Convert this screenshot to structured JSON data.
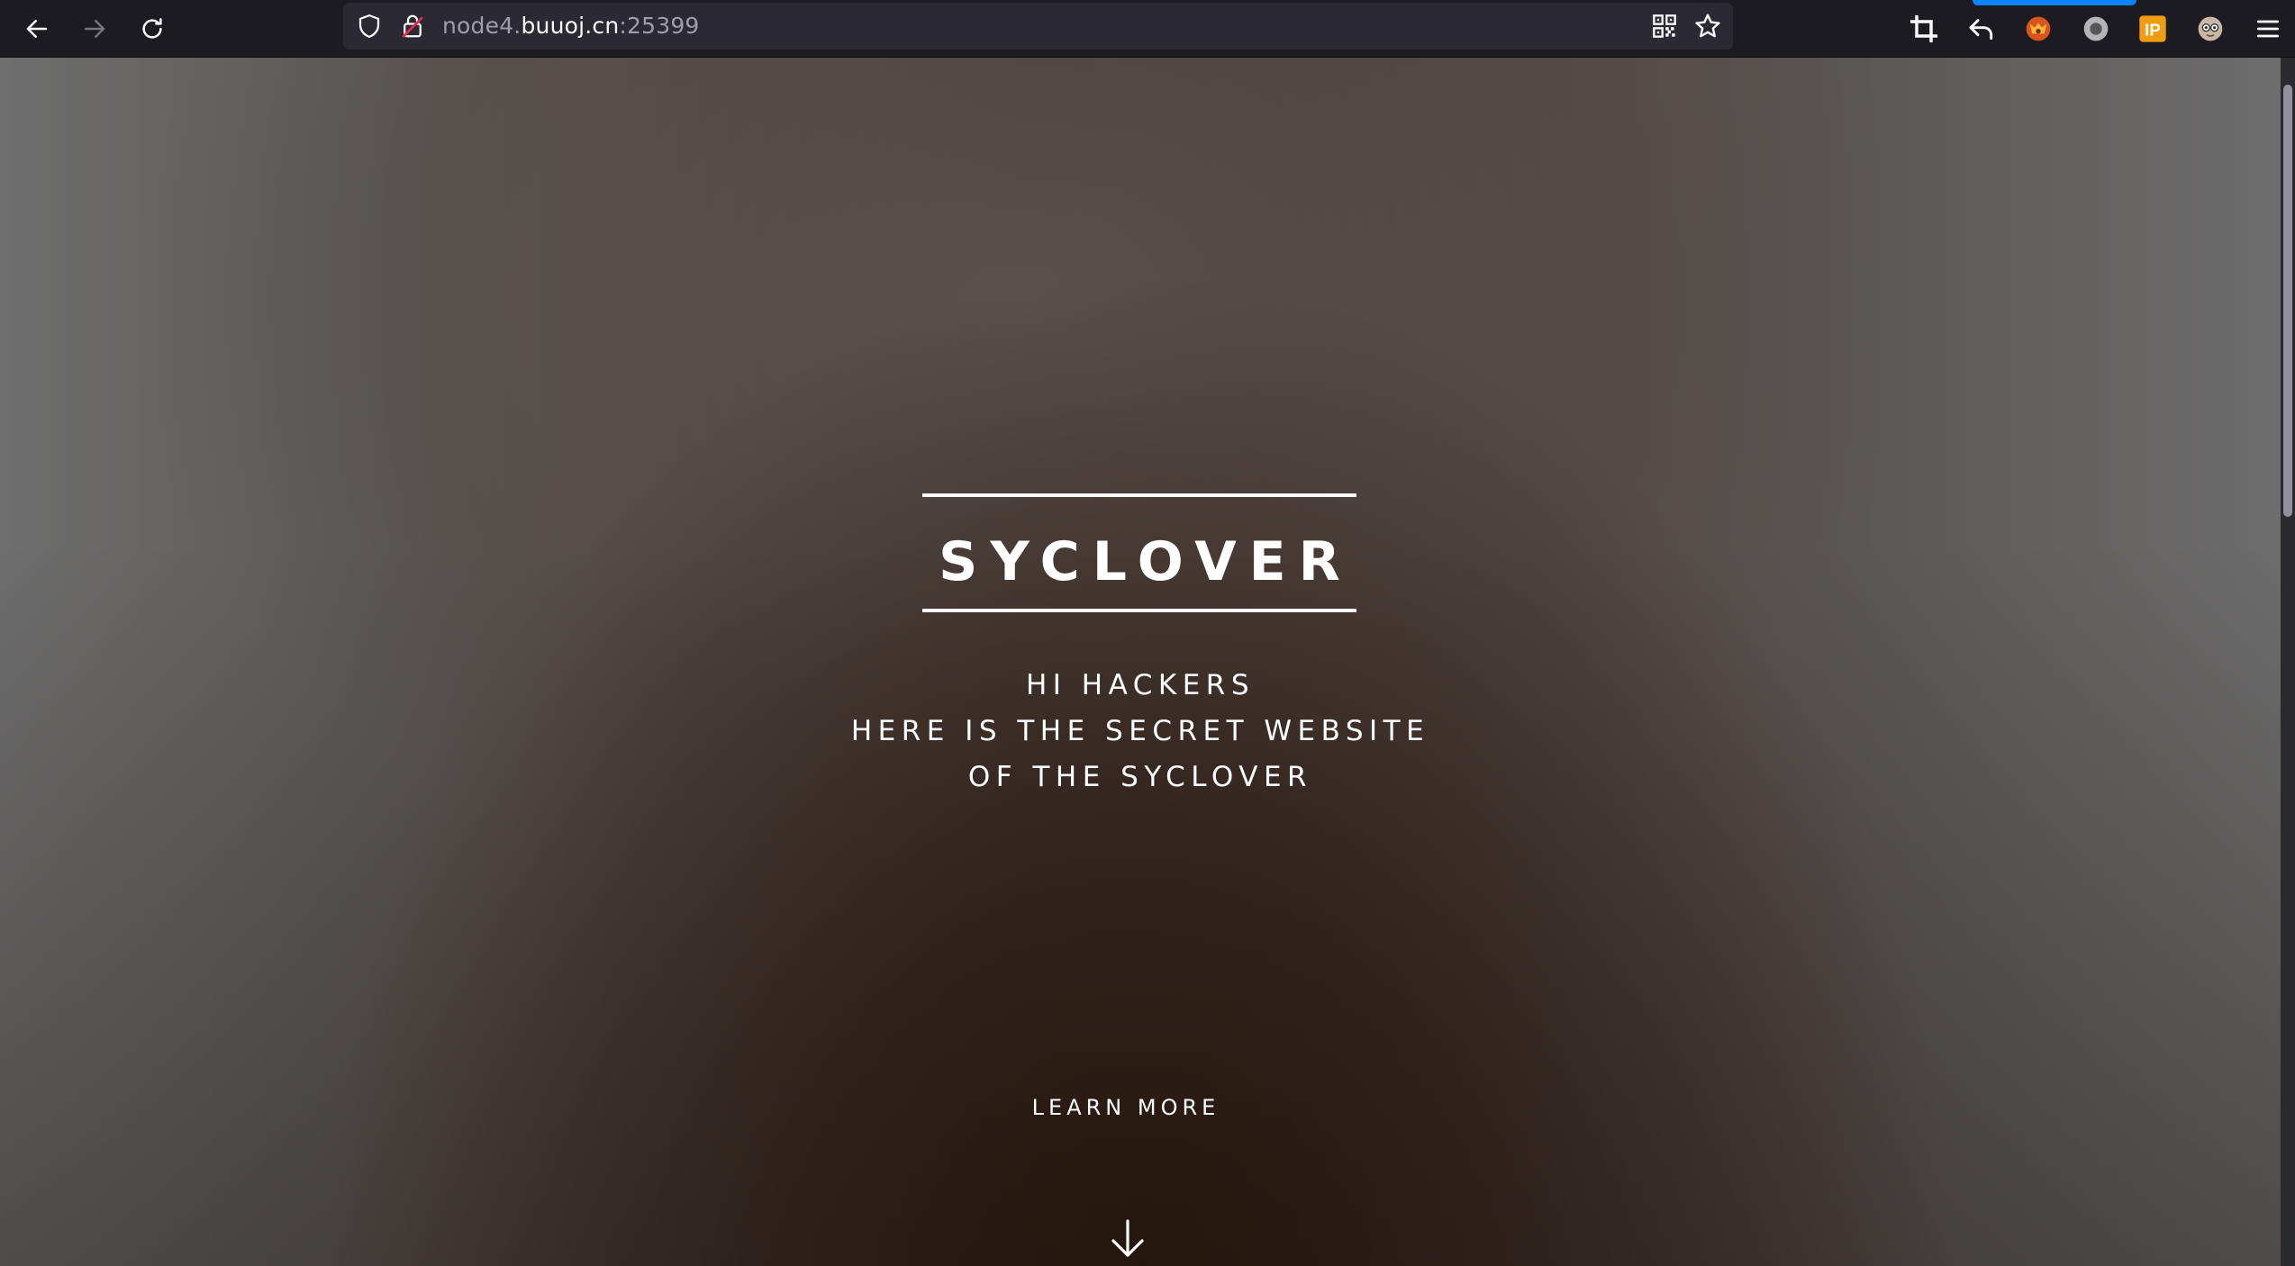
{
  "browser": {
    "url": {
      "prefix": "node4.",
      "host": "buuoj.cn",
      "port": ":25399"
    },
    "nav": {
      "back_icon": "arrow-left-icon",
      "forward_icon": "arrow-right-icon",
      "reload_icon": "reload-icon"
    },
    "url_icons": [
      "shield-icon",
      "insecure-lock-icon",
      "qr-code-icon",
      "bookmark-star-icon"
    ],
    "extensions": [
      "crop-icon",
      "undo-arrow-icon",
      "fox-extension-icon",
      "circle-extension-icon",
      "ip-extension-icon",
      "avatar-extension-icon",
      "hamburger-menu-icon"
    ],
    "ip_badge": "IP",
    "colors": {
      "toolbar": "#1c1b22",
      "urlbar": "#2b2a33",
      "accent": "#0a84ff"
    }
  },
  "page": {
    "brand": "SYCLOVER",
    "intro_lines": [
      "HI HACKERS",
      "HERE IS THE SECRET WEBSITE",
      "OF THE SYCLOVER"
    ],
    "learn_more": "LEARN MORE",
    "learn_more_icon": "arrow-down-icon",
    "colors": {
      "text": "#ffffff",
      "background_dark": "#2c190e",
      "background_edge": "#6e6e6e"
    }
  }
}
